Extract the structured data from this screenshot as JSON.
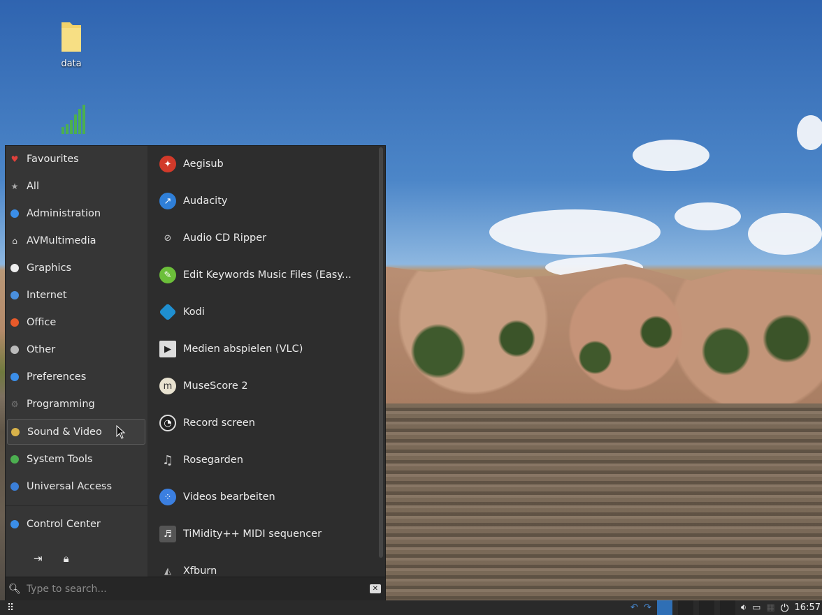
{
  "desktop": {
    "icons": [
      {
        "label": "data",
        "icon": "folder-icon"
      },
      {
        "label": "",
        "icon": "signal-bars-icon"
      }
    ]
  },
  "menu": {
    "categories": [
      {
        "label": "Favourites",
        "icon": "heart-icon",
        "color": "#e0403b"
      },
      {
        "label": "All",
        "icon": "star-icon",
        "color": "#aaaaaa"
      },
      {
        "label": "Administration",
        "icon": "administration-icon",
        "color": "#3b8ee8"
      },
      {
        "label": "AVMultimedia",
        "icon": "home-icon",
        "color": "#dddddd"
      },
      {
        "label": "Graphics",
        "icon": "graphics-icon",
        "color": "#eeeeee"
      },
      {
        "label": "Internet",
        "icon": "internet-icon",
        "color": "#4a8fdc"
      },
      {
        "label": "Office",
        "icon": "office-icon",
        "color": "#e85a2a"
      },
      {
        "label": "Other",
        "icon": "other-icon",
        "color": "#bbbbbb"
      },
      {
        "label": "Preferences",
        "icon": "preferences-icon",
        "color": "#3b8ee8"
      },
      {
        "label": "Programming",
        "icon": "gear-icon",
        "color": "#777777"
      },
      {
        "label": "Sound & Video",
        "icon": "sound-video-icon",
        "color": "#d8b24a"
      },
      {
        "label": "System Tools",
        "icon": "system-tools-icon",
        "color": "#4caf50"
      },
      {
        "label": "Universal Access",
        "icon": "info-icon",
        "color": "#3b7fd8"
      }
    ],
    "control_center": "Control Center",
    "apps": [
      {
        "label": "Aegisub",
        "icon": "aegisub-icon",
        "color": "#d23a2a"
      },
      {
        "label": "Audacity",
        "icon": "audacity-icon",
        "color": "#2f7fd8"
      },
      {
        "label": "Audio CD Ripper",
        "icon": "cd-ripper-icon",
        "color": "transparent"
      },
      {
        "label": "Edit Keywords Music Files (Easy...",
        "icon": "easytag-icon",
        "color": "#6cbf3a"
      },
      {
        "label": "Kodi",
        "icon": "kodi-icon",
        "color": "#1f8fd0"
      },
      {
        "label": "Medien abspielen (VLC)",
        "icon": "clapperboard-icon",
        "color": "transparent"
      },
      {
        "label": "MuseScore 2",
        "icon": "musescore-icon",
        "color": "#e8e2d0"
      },
      {
        "label": "Record screen",
        "icon": "obs-icon",
        "color": "#222222"
      },
      {
        "label": "Rosegarden",
        "icon": "music-note-icon",
        "color": "transparent"
      },
      {
        "label": "Videos bearbeiten",
        "icon": "video-editor-icon",
        "color": "#3b7fe0"
      },
      {
        "label": "TiMidity++ MIDI sequencer",
        "icon": "timidity-icon",
        "color": "#555555"
      },
      {
        "label": "Xfburn",
        "icon": "xfburn-icon",
        "color": "#bbbbbb"
      }
    ],
    "search_placeholder": "Type to search..."
  },
  "taskbar": {
    "clock": "16:57"
  }
}
